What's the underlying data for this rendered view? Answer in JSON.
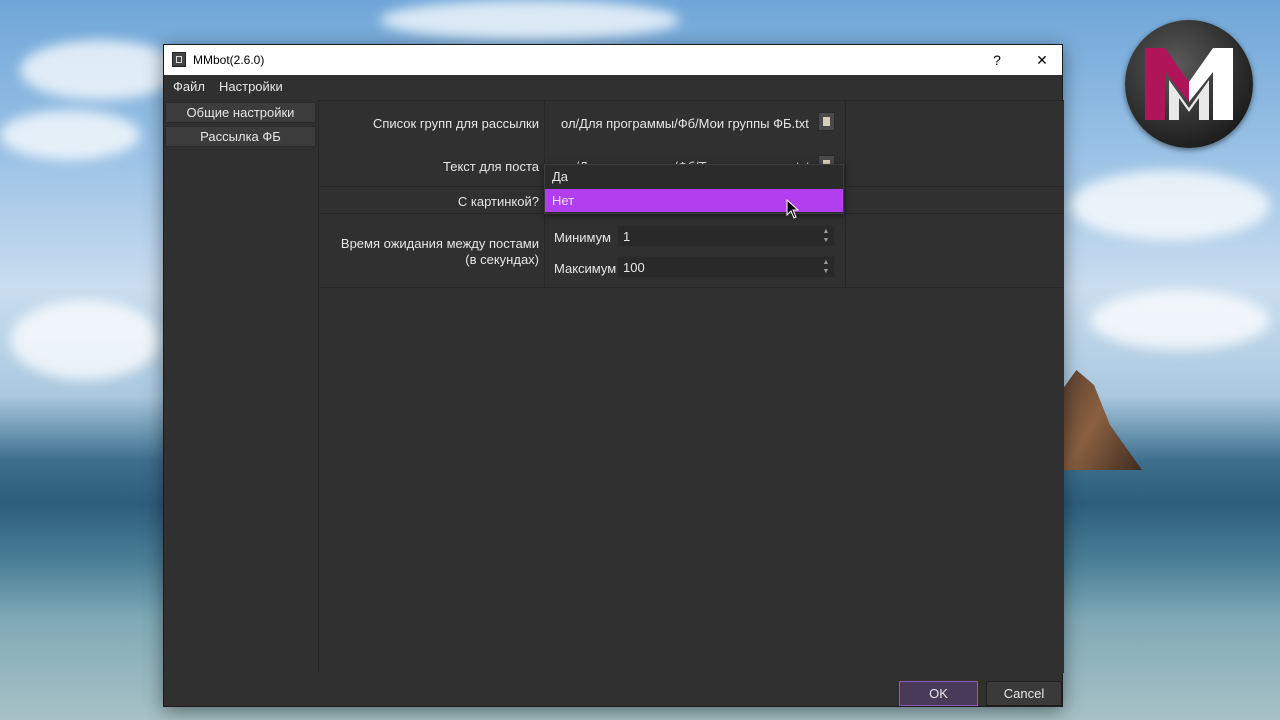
{
  "window": {
    "title": "MMbot(2.6.0)",
    "help_label": "?",
    "close_label": "✕"
  },
  "menu": {
    "file": "Файл",
    "settings": "Настройки"
  },
  "sidebar": {
    "items": [
      {
        "label": "Общие настройки"
      },
      {
        "label": "Рассылка ФБ"
      }
    ]
  },
  "form": {
    "groups_list_label": "Список групп для рассылки",
    "groups_list_value": "ол/Для программы/Фб/Мои группы ФБ.txt",
    "post_text_label": "Текст для поста",
    "post_text_value": "ол/Для программы/Фб/Текст рассылки.txt",
    "with_image_label": "С картинкой?",
    "wait_label": "Время ожидания между постами (в секундах)",
    "min_label": "Минимум",
    "min_value": "1",
    "max_label": "Максимум",
    "max_value": "100"
  },
  "dropdown": {
    "options": [
      "Да",
      "Нет"
    ],
    "selected": "Нет"
  },
  "buttons": {
    "ok": "OK",
    "cancel": "Cancel"
  },
  "colors": {
    "accent": "#b13ff0",
    "window_bg": "#303030"
  }
}
